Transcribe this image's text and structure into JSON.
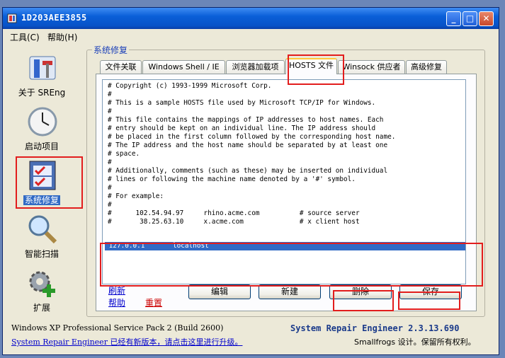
{
  "window": {
    "title": "1D203AEE3855"
  },
  "menu": [
    {
      "label": "工具(C)"
    },
    {
      "label": "帮助(H)"
    }
  ],
  "titlebar_buttons": {
    "minimize": "_",
    "maximize": "□",
    "close": "✕"
  },
  "sidebar": {
    "items": [
      {
        "label": "关于 SREng",
        "icon": "tools-icon"
      },
      {
        "label": "启动项目",
        "icon": "clock-icon"
      },
      {
        "label": "系统修复",
        "icon": "checklist-icon",
        "selected": true
      },
      {
        "label": "智能扫描",
        "icon": "magnifier-icon"
      },
      {
        "label": "扩展",
        "icon": "gear-plus-icon"
      }
    ]
  },
  "group": {
    "title": "系统修复"
  },
  "tabs": [
    {
      "label": "文件关联"
    },
    {
      "label": "Windows Shell / IE"
    },
    {
      "label": "浏览器加载项"
    },
    {
      "label": "HOSTS 文件",
      "active": true
    },
    {
      "label": "Winsock 供应者"
    },
    {
      "label": "高级修复"
    }
  ],
  "hosts": {
    "lines": [
      "# Copyright (c) 1993-1999 Microsoft Corp.",
      "#",
      "# This is a sample HOSTS file used by Microsoft TCP/IP for Windows.",
      "#",
      "# This file contains the mappings of IP addresses to host names. Each",
      "# entry should be kept on an individual line. The IP address should",
      "# be placed in the first column followed by the corresponding host name.",
      "# The IP address and the host name should be separated by at least one",
      "# space.",
      "#",
      "# Additionally, comments (such as these) may be inserted on individual",
      "# lines or following the machine name denoted by a '#' symbol.",
      "#",
      "# For example:",
      "#",
      "#      102.54.94.97     rhino.acme.com          # source server",
      "#       38.25.63.10     x.acme.com              # x client host"
    ],
    "selected_entry": "127.0.0.1       localhost"
  },
  "links": {
    "refresh": "刷新",
    "help": "帮助",
    "reset": "重置"
  },
  "buttons": {
    "edit": "编辑",
    "new": "新建",
    "delete": "删除",
    "save": "保存"
  },
  "status": {
    "os": "Windows XP Professional Service Pack 2 (Build 2600)",
    "update_notice": "System Repair Engineer 已经有新版本，请点击这里进行升级。",
    "product": "System Repair Engineer 2.3.13.690",
    "copyright": "Smallfrogs 设计。保留所有权利。"
  },
  "colors": {
    "accent": "#0a5fd8",
    "selection": "#316ac5",
    "highlight_box": "#e21d1d",
    "link_blue": "#0000cc",
    "link_red": "#cc0000"
  }
}
